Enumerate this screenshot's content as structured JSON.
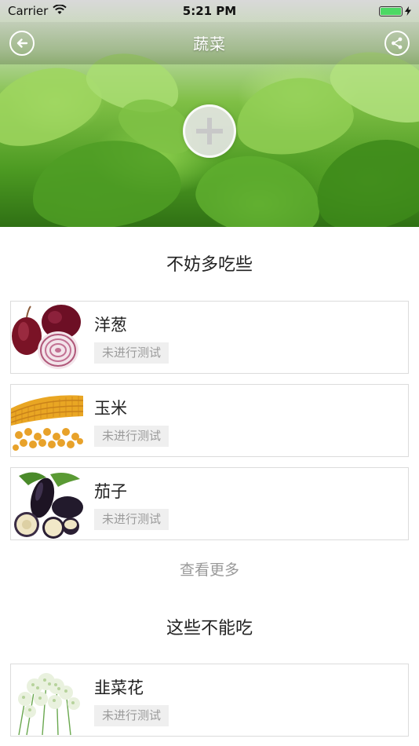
{
  "status": {
    "carrier": "Carrier",
    "time": "5:21 PM"
  },
  "nav": {
    "title": "蔬菜"
  },
  "sections": [
    {
      "title": "不妨多吃些",
      "items": [
        {
          "name": "洋葱",
          "tag": "未进行测试"
        },
        {
          "name": "玉米",
          "tag": "未进行测试"
        },
        {
          "name": "茄子",
          "tag": "未进行测试"
        }
      ],
      "more": "查看更多"
    },
    {
      "title": "这些不能吃",
      "items": [
        {
          "name": "韭菜花",
          "tag": "未进行测试"
        }
      ]
    }
  ],
  "icons": {
    "back": "back-arrow-icon",
    "share": "share-icon",
    "add": "plus-icon",
    "wifi": "wifi-icon",
    "battery": "battery-icon"
  },
  "colors": {
    "battery": "#4cd964",
    "tag_bg": "#efefef",
    "tag_text": "#9b9b9b"
  }
}
